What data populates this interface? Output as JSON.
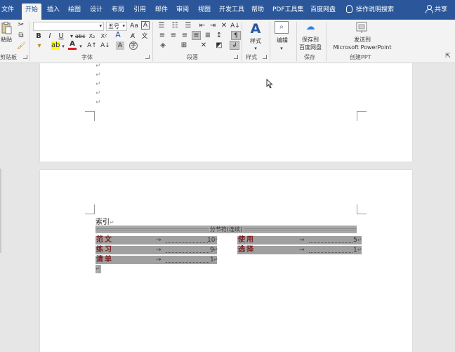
{
  "tabs": [
    "文件",
    "开始",
    "插入",
    "绘图",
    "设计",
    "布局",
    "引用",
    "邮件",
    "审阅",
    "视图",
    "开发工具",
    "帮助",
    "PDF工具集",
    "百度网盘"
  ],
  "active_tab": "开始",
  "tell_me": "操作说明搜索",
  "share": "共享",
  "ribbon": {
    "clipboard": {
      "paste": "粘贴",
      "label": "剪贴板"
    },
    "font": {
      "font_name": "",
      "font_size": "五号",
      "label": "字体"
    },
    "paragraph": {
      "label": "段落"
    },
    "styles": {
      "button": "样式",
      "label": "样式"
    },
    "editing": {
      "button": "编辑"
    },
    "save": {
      "button_line1": "保存到",
      "button_line2": "百度网盘",
      "label": "保存"
    },
    "ppt": {
      "button_line1": "发送到",
      "button_line2": "Microsoft PowerPoint",
      "label": "创建PPT"
    }
  },
  "document": {
    "para_mark": "↵",
    "index_title": "索引",
    "section_break": "分节符(连续)",
    "arrow": "→",
    "index_entries": [
      {
        "term": "范文",
        "page": "10"
      },
      {
        "term": "练习",
        "page": "9"
      },
      {
        "term": "清单",
        "page": "1"
      },
      {
        "term": "使用",
        "page": "5"
      },
      {
        "term": "选择",
        "page": "1"
      }
    ]
  }
}
